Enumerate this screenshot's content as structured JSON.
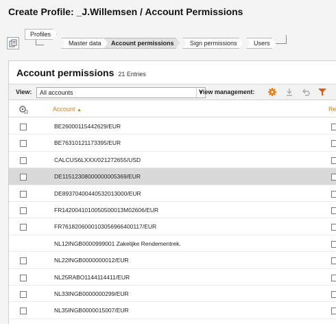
{
  "header": {
    "title": "Create Profile: _J.Willemsen / Account Permissions"
  },
  "breadcrumb": {
    "items": [
      {
        "label": "Profiles"
      },
      {
        "label": "Master data"
      },
      {
        "label": "Account permissions"
      },
      {
        "label": "Sign permissions"
      },
      {
        "label": "Users"
      }
    ],
    "active_index": 2
  },
  "panel": {
    "title": "Account permissions",
    "count": "21 Entries"
  },
  "viewbar": {
    "view_label": "View:",
    "view_value": "All accounts",
    "view_management_label": "View management:",
    "tools": [
      "gear-icon",
      "download-icon",
      "undo-icon",
      "filter-icon"
    ],
    "gear_color": "#e8780e",
    "filter_color": "#e05a0a"
  },
  "grid": {
    "col_account": "Account",
    "col_account_sort": "▲",
    "col_right": "Re",
    "header_color": "#e07a10",
    "rows": [
      {
        "account": "BE26000115442629/EUR",
        "checkbox": true,
        "selected": false
      },
      {
        "account": "BE76310121173395/EUR",
        "checkbox": true,
        "selected": false
      },
      {
        "account": "CALCUS6LXXX/021272655/USD",
        "checkbox": true,
        "selected": false
      },
      {
        "account": "DE11512308000000005369/EUR",
        "checkbox": true,
        "selected": true
      },
      {
        "account": "DE89370400440532013000/EUR",
        "checkbox": true,
        "selected": false
      },
      {
        "account": "FR1420041010050500013M02606/EUR",
        "checkbox": true,
        "selected": false
      },
      {
        "account": "FR7618206000103056966400117/EUR",
        "checkbox": true,
        "selected": false
      },
      {
        "account": "NL12INGB0000999001 Zakelijke Rendementrek.",
        "checkbox": false,
        "selected": false
      },
      {
        "account": "NL22INGB0000000012/EUR",
        "checkbox": true,
        "selected": false
      },
      {
        "account": "NL25RABO1144114411/EUR",
        "checkbox": true,
        "selected": false
      },
      {
        "account": "NL33INGB0000000299/EUR",
        "checkbox": true,
        "selected": false
      },
      {
        "account": "NL35INGB0000015007/EUR",
        "checkbox": true,
        "selected": false
      }
    ]
  }
}
